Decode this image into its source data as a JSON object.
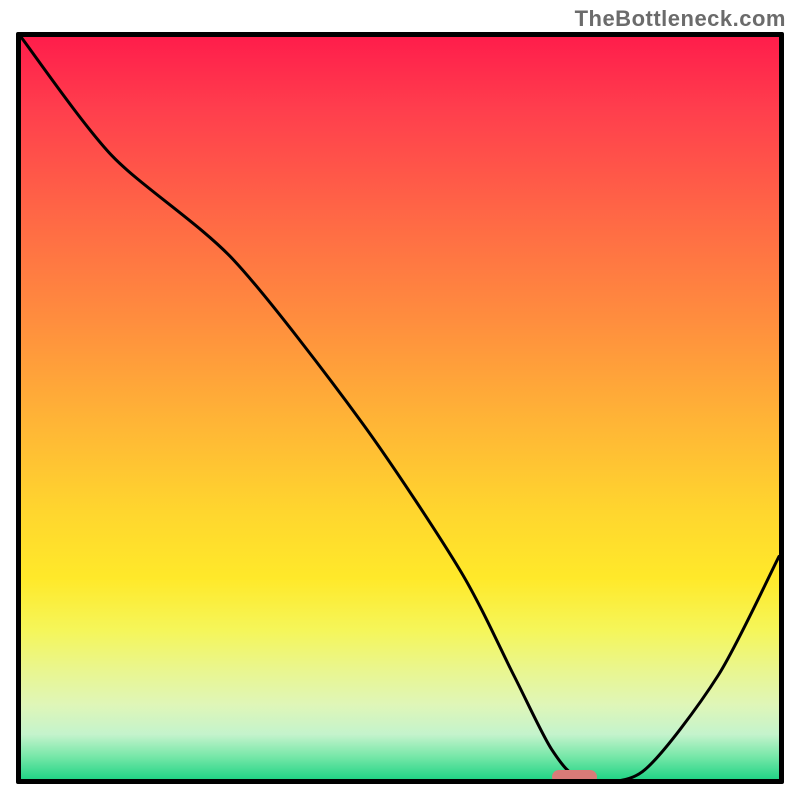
{
  "watermark": "TheBottleneck.com",
  "chart_data": {
    "type": "line",
    "title": "",
    "xlabel": "",
    "ylabel": "",
    "xlim": [
      0,
      100
    ],
    "ylim": [
      0,
      100
    ],
    "grid": false,
    "legend": false,
    "series": [
      {
        "name": "bottleneck-curve",
        "x": [
          0,
          12,
          28,
          45,
          58,
          65,
          70,
          74,
          82,
          92,
          100
        ],
        "values": [
          100,
          84,
          70,
          48,
          28,
          14,
          4,
          0,
          1,
          14,
          30
        ]
      }
    ],
    "marker": {
      "x_start": 70,
      "x_end": 76,
      "y": 0
    },
    "background_gradient": {
      "top": "#ff1d4b",
      "mid": "#ffd62e",
      "bottom": "#22d486"
    }
  },
  "frame": {
    "inner_w": 758,
    "inner_h": 742
  }
}
